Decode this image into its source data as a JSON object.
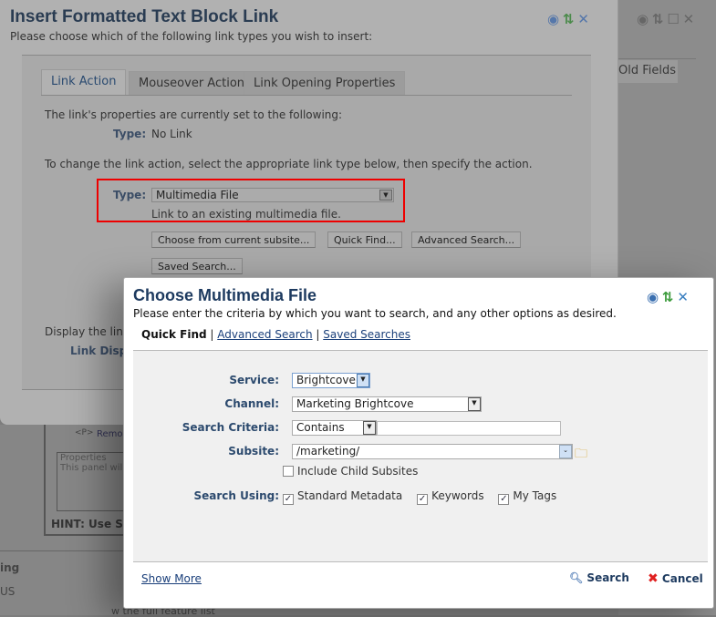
{
  "background": {
    "tab_label": "Old Fields",
    "hint": "HINT: Use S",
    "properties_legend": "Properties",
    "properties_text": "This panel wil",
    "remove_label": "Remo",
    "p_tag": "<P>",
    "ing_text": "ing",
    "us_text": "US",
    "feature_text": "w the full feature list"
  },
  "back_dialog": {
    "title": "Insert Formatted Text Block Link",
    "subtitle": "Please choose which of the following link types you wish to insert:",
    "tabs": [
      {
        "label": "Link Action",
        "active": true
      },
      {
        "label": "Mouseover Action"
      },
      {
        "label": "Link Opening Properties"
      }
    ],
    "current_intro": "The link's properties are currently set to the following:",
    "current_type_label": "Type:",
    "current_type_value": "No Link",
    "change_text": "To change the link action, select the appropriate link type below, then specify the action.",
    "type_label": "Type:",
    "type_value": "Multimedia File",
    "type_desc": "Link to an existing multimedia file.",
    "buttons": [
      "Choose from current subsite...",
      "Quick Find...",
      "Advanced Search...",
      "Saved Search..."
    ],
    "display_text": "Display the link",
    "link_display_label": "Link Disp"
  },
  "front_dialog": {
    "title": "Choose Multimedia File",
    "subtitle": "Please enter the criteria by which you want to search, and any other options as desired.",
    "nav": {
      "active": "Quick Find",
      "links": [
        "Advanced Search",
        "Saved Searches"
      ]
    },
    "service_label": "Service:",
    "service_value": "Brightcove",
    "channel_label": "Channel:",
    "channel_value": "Marketing Brightcove",
    "criteria_label": "Search Criteria:",
    "criteria_value": "Contains",
    "criteria_text": "",
    "subsite_label": "Subsite:",
    "subsite_value": "/marketing/",
    "include_child": {
      "label": "Include Child Subsites",
      "checked": false
    },
    "search_using_label": "Search Using:",
    "search_using": [
      {
        "label": "Standard Metadata",
        "checked": true
      },
      {
        "label": "Keywords",
        "checked": true
      },
      {
        "label": "My Tags",
        "checked": true
      }
    ],
    "show_more": "Show More",
    "search_button": "Search",
    "cancel_button": "Cancel"
  },
  "colors": {
    "title": "#1d3a5f",
    "highlight": "#e00000",
    "help": "#3a6fb0",
    "refresh": "#3a9a3a",
    "close": "#3a7fc0"
  }
}
